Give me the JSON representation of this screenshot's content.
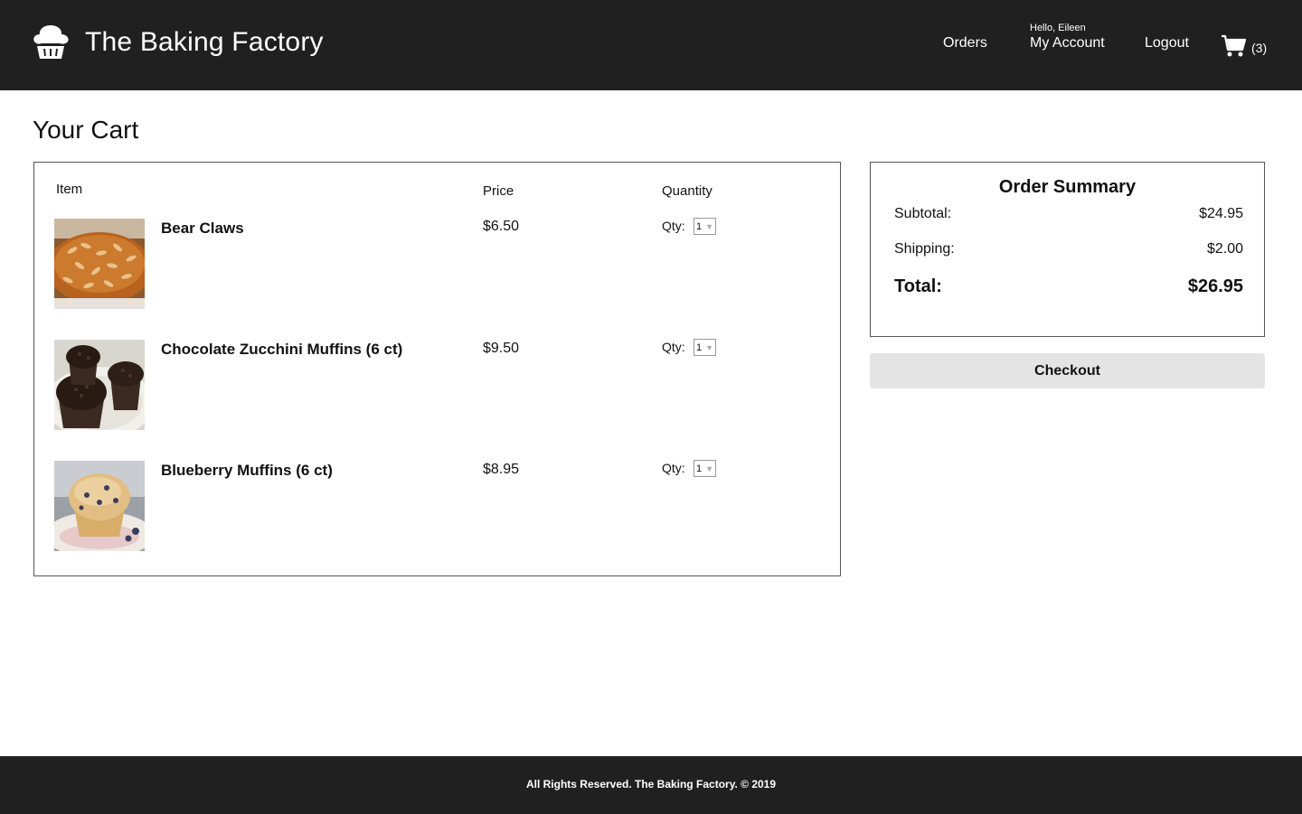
{
  "header": {
    "brand": "The Baking Factory",
    "logo_icon": "cupcake-icon",
    "nav": {
      "orders": "Orders",
      "greeting": "Hello, Eileen",
      "account": "My Account",
      "logout": "Logout"
    },
    "cart": {
      "icon": "cart-icon",
      "count": "(3)"
    }
  },
  "page": {
    "title": "Your Cart"
  },
  "cart": {
    "columns": {
      "item": "Item",
      "price": "Price",
      "quantity": "Quantity"
    },
    "qty_label": "Qty:",
    "items": [
      {
        "name": "Bear Claws",
        "price": "$6.50",
        "qty": "1",
        "image": "bear-claws-photo"
      },
      {
        "name": "Chocolate Zucchini Muffins (6 ct)",
        "price": "$9.50",
        "qty": "1",
        "image": "chocolate-muffins-photo"
      },
      {
        "name": "Blueberry Muffins (6 ct)",
        "price": "$8.95",
        "qty": "1",
        "image": "blueberry-muffin-photo"
      }
    ]
  },
  "summary": {
    "title": "Order Summary",
    "subtotal_label": "Subtotal:",
    "subtotal_value": "$24.95",
    "shipping_label": "Shipping:",
    "shipping_value": "$2.00",
    "total_label": "Total:",
    "total_value": "$26.95",
    "checkout_label": "Checkout"
  },
  "footer": {
    "text": "All Rights Reserved. The Baking Factory. © 2019"
  },
  "colors": {
    "header_bg": "#202020",
    "footer_bg": "#202020",
    "checkout_bg": "#e4e4e4",
    "border": "#555555"
  }
}
